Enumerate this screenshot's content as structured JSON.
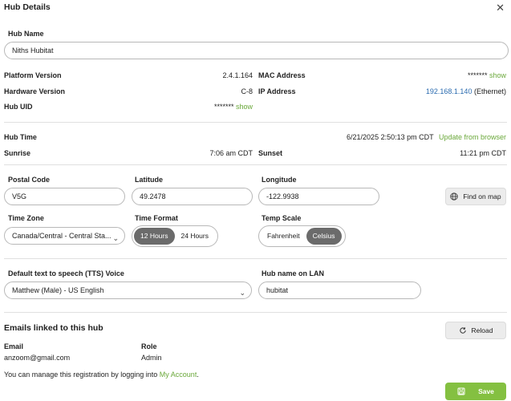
{
  "dialog": {
    "title": "Hub Details",
    "close_icon": "close-icon"
  },
  "hub_name": {
    "label": "Hub Name",
    "value": "Niths Hubitat"
  },
  "info": {
    "platform_version_label": "Platform Version",
    "platform_version_value": "2.4.1.164",
    "hardware_version_label": "Hardware Version",
    "hardware_version_value": "C-8",
    "hub_uid_label": "Hub UID",
    "hub_uid_masked": "*******",
    "hub_uid_show": "show",
    "mac_label": "MAC Address",
    "mac_masked": "*******",
    "mac_show": "show",
    "ip_label": "IP Address",
    "ip_value": "192.168.1.140",
    "ip_suffix": "(Ethernet)"
  },
  "time": {
    "hub_time_label": "Hub Time",
    "hub_time_value": "6/21/2025 2:50:13 pm CDT",
    "update_link": "Update from browser",
    "sunrise_label": "Sunrise",
    "sunrise_value": "7:06 am CDT",
    "sunset_label": "Sunset",
    "sunset_value": "11:21 pm CDT"
  },
  "location": {
    "postal_label": "Postal Code",
    "postal_value": "V5G",
    "latitude_label": "Latitude",
    "latitude_value": "49.2478",
    "longitude_label": "Longitude",
    "longitude_value": "-122.9938",
    "find_on_map": "Find on map",
    "find_icon": "globe-icon"
  },
  "settings": {
    "timezone_label": "Time Zone",
    "timezone_value": "Canada/Central - Central Sta...",
    "time_format_label": "Time Format",
    "time_format_options": [
      "12 Hours",
      "24 Hours"
    ],
    "time_format_selected": "12 Hours",
    "temp_scale_label": "Temp Scale",
    "temp_scale_options": [
      "Fahrenheit",
      "Celsius"
    ],
    "temp_scale_selected": "Celsius"
  },
  "tts": {
    "label": "Default text to speech (TTS) Voice",
    "value": "Matthew (Male) - US English",
    "lan_label": "Hub name on LAN",
    "lan_value": "hubitat"
  },
  "emails": {
    "heading": "Emails linked to this hub",
    "reload": "Reload",
    "reload_icon": "reload-icon",
    "col_email": "Email",
    "col_role": "Role",
    "rows": [
      {
        "email": "anzoom@gmail.com",
        "role": "Admin"
      }
    ],
    "manage_text": "You can manage this registration by logging into ",
    "manage_link": "My Account",
    "manage_end": "."
  },
  "footer": {
    "save": "Save",
    "save_icon": "save-icon"
  },
  "colors": {
    "accent_green": "#84c041",
    "link_blue": "#2b6cb0",
    "segment_active": "#6b6b6b"
  }
}
